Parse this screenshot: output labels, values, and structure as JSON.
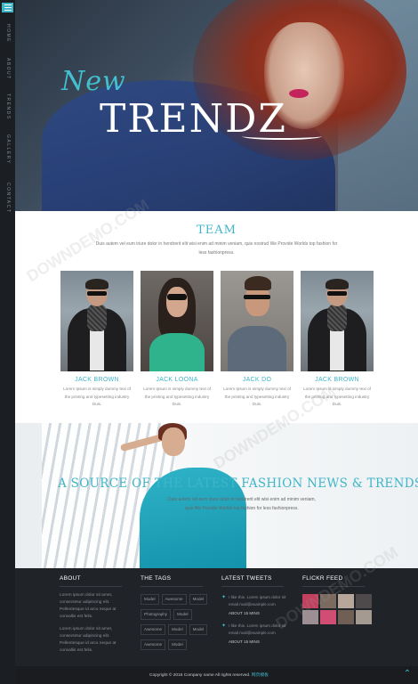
{
  "nav": {
    "items": [
      "HOME",
      "ABOUT",
      "TRENDS",
      "GALLERY",
      "CONTACT"
    ]
  },
  "hero": {
    "title_small": "New",
    "title_big": "TRENDZ"
  },
  "team": {
    "title": "TEAM",
    "subtitle": "Duis autem vel eum iriure dolor in hendrerit elit wisi enim ad minim veniam, quis nostrud We Provide Worlds top fashion for less fashionpress.",
    "members": [
      {
        "name": "JACK BROWN",
        "desc": "Lorem Ipsum is simply dummy text of the printing and typesetting industry Duis."
      },
      {
        "name": "JACK LOONA",
        "desc": "Lorem Ipsum is simply dummy text of the printing and typesetting industry Duis."
      },
      {
        "name": "JACK DO",
        "desc": "Lorem Ipsum is simply dummy text of the printing and typesetting industry Duis."
      },
      {
        "name": "JACK BROWN",
        "desc": "Lorem Ipsum is simply dummy text of the printing and typesetting industry Duis."
      }
    ]
  },
  "news": {
    "title": "A SOURCE OF THE LATEST FASHION NEWS & TRENDS",
    "subtitle": "Duis autem vel eum iriure dolor in hendrerit elit wisi enim ad minim veniam, quis We Provide Worlds top fashion for less fashionpress."
  },
  "footer": {
    "about": {
      "heading": "ABOUT",
      "p1": "Lorem ipsum dolor sit amet, consectetur adipiscing elit. Pellentesque id arcu neque at convallis est felis.",
      "p2": "Lorem ipsum dolor sit amet, consectetur adipiscing elit. Pellentesque id arcu neque at convallis est felis."
    },
    "tags": {
      "heading": "THE TAGS",
      "items": [
        "Model",
        "Awesome",
        "Model",
        "Photography",
        "Model",
        "Awesome",
        "Model",
        "Model",
        "Awesome",
        "Model"
      ]
    },
    "tweets": {
      "heading": "LATEST TWEETS",
      "items": [
        {
          "text": "I like this. Lorem ipsum dolor sit email mail@example.com",
          "time": "ABOUT 15 MINS"
        },
        {
          "text": "I like this. Lorem ipsum dolor sit email mail@example.com",
          "time": "ABOUT 15 MINS"
        }
      ]
    },
    "flickr": {
      "heading": "FLICKR FEED"
    },
    "copyright_text": "Copyright © 2015 Company name All rights reserved.",
    "copyright_link": "网页模板"
  },
  "watermark": "DOWNDEMO.COM"
}
